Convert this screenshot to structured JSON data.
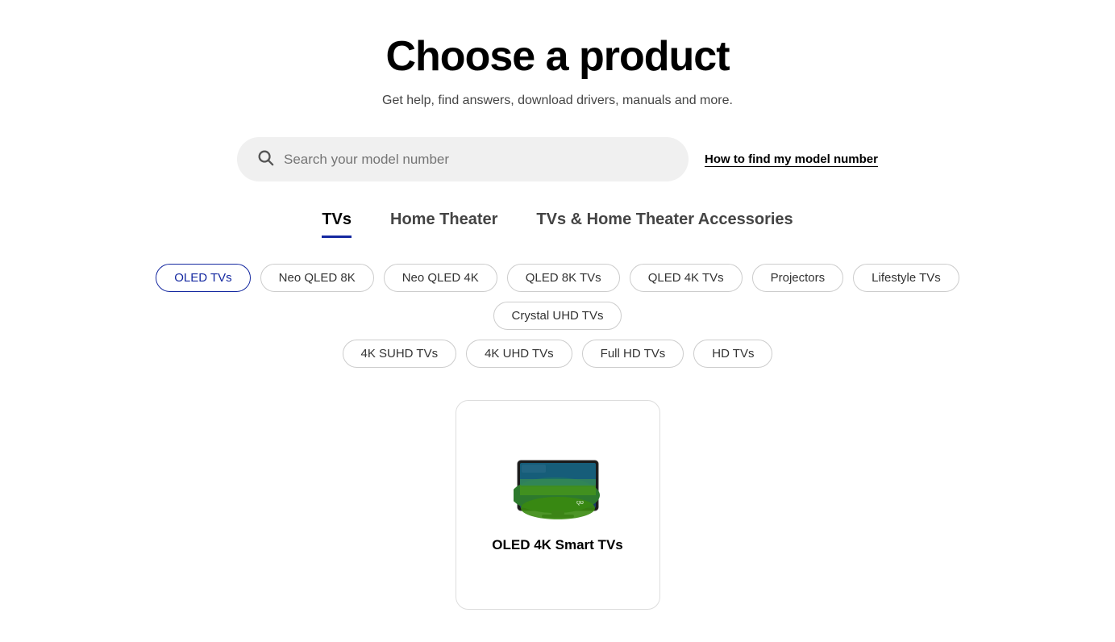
{
  "header": {
    "title": "Choose a product",
    "subtitle": "Get help, find answers, download drivers, manuals and more."
  },
  "search": {
    "placeholder": "Search your model number",
    "help_link": "How to find my model number"
  },
  "tabs": [
    {
      "id": "tvs",
      "label": "TVs",
      "active": true
    },
    {
      "id": "home-theater",
      "label": "Home Theater",
      "active": false
    },
    {
      "id": "accessories",
      "label": "TVs & Home Theater Accessories",
      "active": false
    }
  ],
  "filter_row1": [
    {
      "id": "oled-tvs",
      "label": "OLED TVs",
      "active": true
    },
    {
      "id": "neo-qled-8k",
      "label": "Neo QLED 8K",
      "active": false
    },
    {
      "id": "neo-qled-4k",
      "label": "Neo QLED 4K",
      "active": false
    },
    {
      "id": "qled-8k-tvs",
      "label": "QLED 8K TVs",
      "active": false
    },
    {
      "id": "qled-4k-tvs",
      "label": "QLED 4K TVs",
      "active": false
    },
    {
      "id": "projectors",
      "label": "Projectors",
      "active": false
    },
    {
      "id": "lifestyle-tvs",
      "label": "Lifestyle TVs",
      "active": false
    },
    {
      "id": "crystal-uhd-tvs",
      "label": "Crystal UHD TVs",
      "active": false
    }
  ],
  "filter_row2": [
    {
      "id": "4k-suhd-tvs",
      "label": "4K SUHD TVs",
      "active": false
    },
    {
      "id": "4k-uhd-tvs",
      "label": "4K UHD TVs",
      "active": false
    },
    {
      "id": "full-hd-tvs",
      "label": "Full HD TVs",
      "active": false
    },
    {
      "id": "hd-tvs",
      "label": "HD TVs",
      "active": false
    }
  ],
  "products": [
    {
      "id": "oled-4k-smart-tvs",
      "label": "OLED 4K Smart TVs"
    }
  ]
}
